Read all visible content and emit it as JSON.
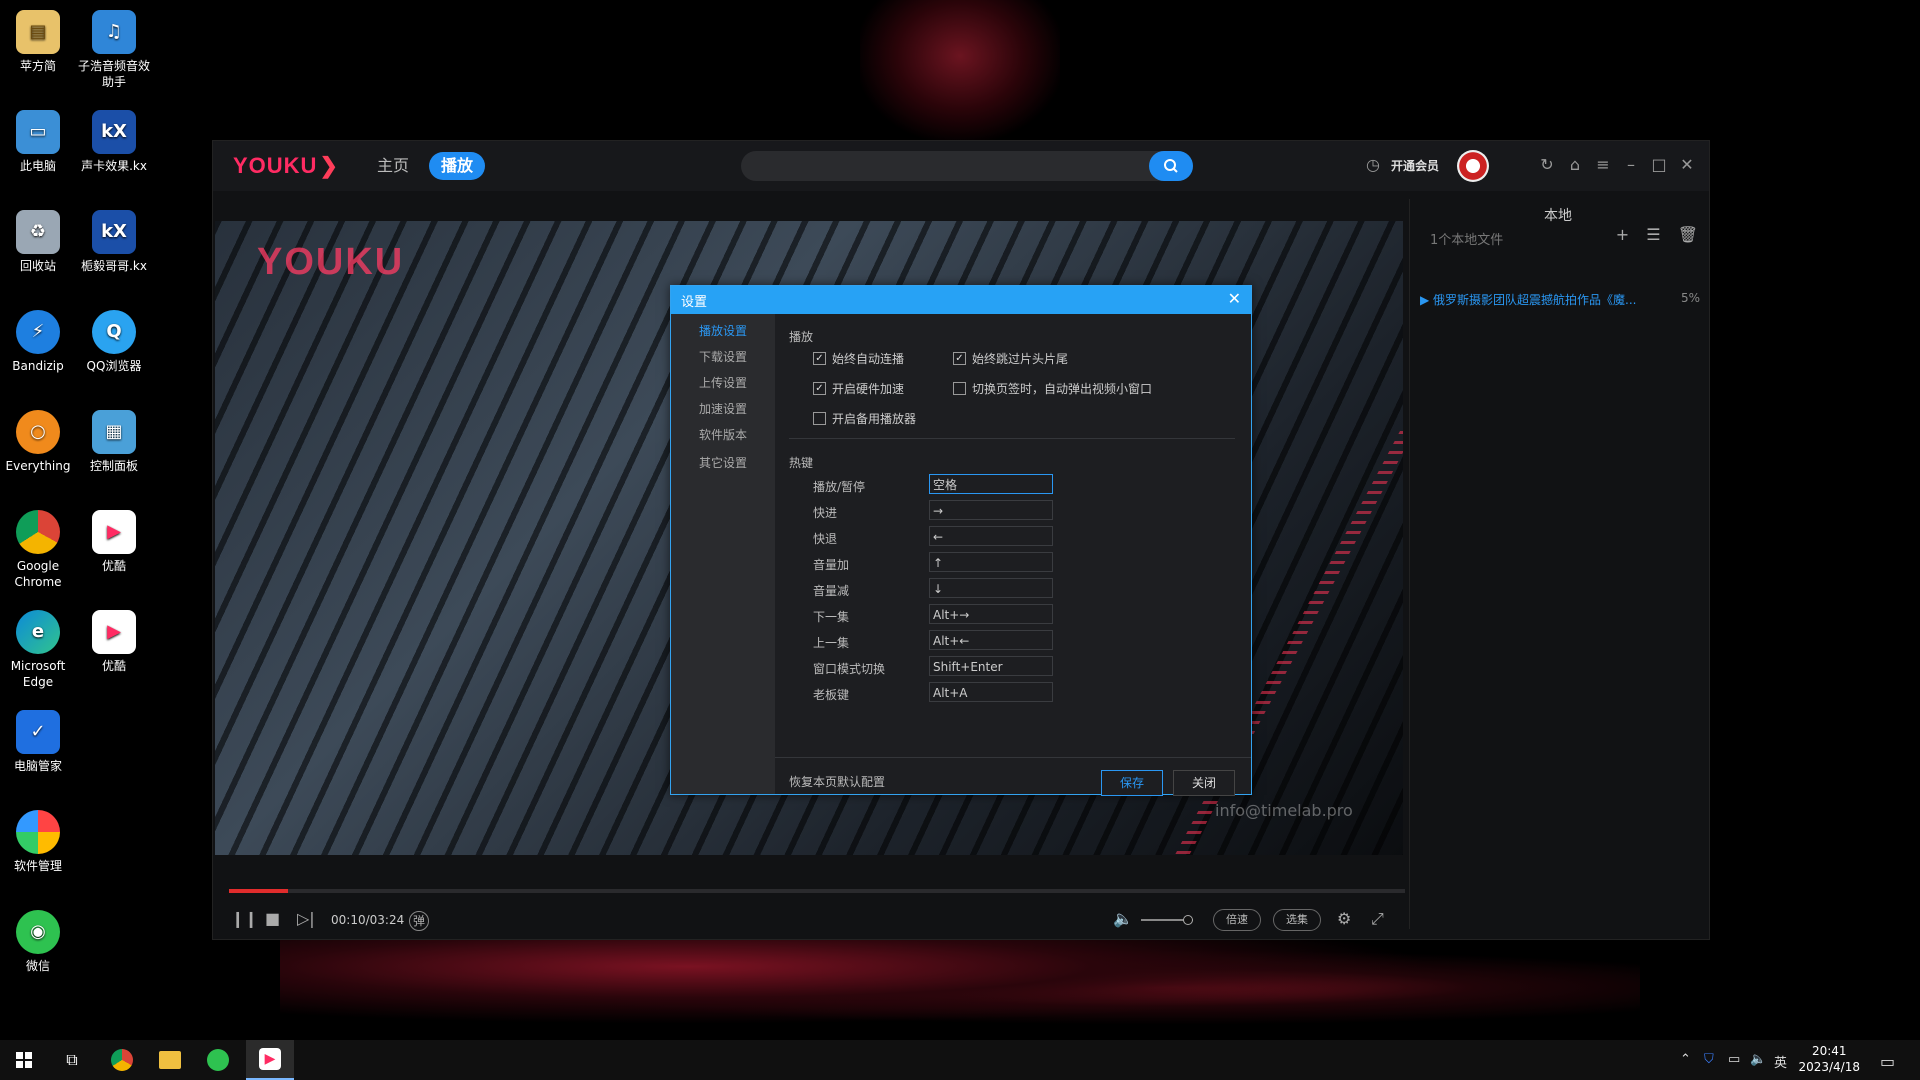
{
  "desktop": {
    "icons": [
      {
        "label": "苹方简"
      },
      {
        "label": "子浩音频音效助手"
      },
      {
        "label": "此电脑"
      },
      {
        "label": "声卡效果.kx"
      },
      {
        "label": "回收站"
      },
      {
        "label": "栀毅哥哥.kx"
      },
      {
        "label": "Bandizip"
      },
      {
        "label": "QQ浏览器"
      },
      {
        "label": "Everything"
      },
      {
        "label": "控制面板"
      },
      {
        "label": "Google Chrome"
      },
      {
        "label": "优酷"
      },
      {
        "label": "Microsoft Edge"
      },
      {
        "label": "优酷"
      },
      {
        "label": "电脑管家"
      },
      {
        "label": "软件管理"
      },
      {
        "label": "微信"
      }
    ]
  },
  "app": {
    "logo": "YOUKU",
    "nav": {
      "home": "主页",
      "play": "播放"
    },
    "search": {
      "placeholder": ""
    },
    "vip": "开通会员",
    "brand_color": "#ff2b63",
    "accent_color": "#1f8cf2"
  },
  "video": {
    "logo": "YOUKU",
    "watermark": "info@timelab.pro",
    "time": "00:10/03:24",
    "progress_fraction": 0.05,
    "danmaku": "弹",
    "speed_label": "倍速",
    "episodes_label": "选集"
  },
  "side": {
    "title": "本地",
    "subtitle": "1个本地文件",
    "item_title": "俄罗斯摄影团队超震撼航拍作品《魔...",
    "item_percent": "5%"
  },
  "settings": {
    "title": "设置",
    "tabs": [
      "播放设置",
      "下载设置",
      "上传设置",
      "加速设置",
      "软件版本",
      "其它设置"
    ],
    "play_section": "播放",
    "options": [
      {
        "label": "始终自动连播",
        "checked": true
      },
      {
        "label": "始终跳过片头片尾",
        "checked": true
      },
      {
        "label": "开启硬件加速",
        "checked": true
      },
      {
        "label": "切换页签时，自动弹出视频小窗口",
        "checked": false
      },
      {
        "label": "开启备用播放器",
        "checked": false
      }
    ],
    "hotkey_section": "热键",
    "hotkeys": [
      {
        "label": "播放/暂停",
        "key": "空格"
      },
      {
        "label": "快进",
        "key": "→"
      },
      {
        "label": "快退",
        "key": "←"
      },
      {
        "label": "音量加",
        "key": "↑"
      },
      {
        "label": "音量减",
        "key": "↓"
      },
      {
        "label": "下一集",
        "key": "Alt+→"
      },
      {
        "label": "上一集",
        "key": "Alt+←"
      },
      {
        "label": "窗口模式切换",
        "key": "Shift+Enter"
      },
      {
        "label": "老板键",
        "key": "Alt+A"
      }
    ],
    "restore": "恢复本页默认配置",
    "save": "保存",
    "close": "关闭"
  },
  "taskbar": {
    "ime": "英",
    "time": "20:41",
    "date": "2023/4/18"
  }
}
